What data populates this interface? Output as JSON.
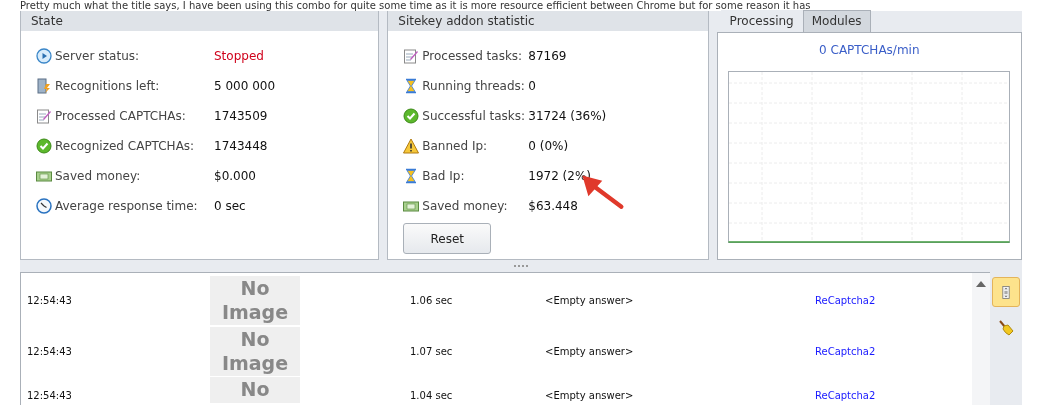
{
  "intro_text": "Pretty much what the title says, I have been using this combo for quite some time as it is more resource efficient between Chrome but for some reason it has",
  "state_panel": {
    "title": "State",
    "rows": [
      {
        "label": "Server status:",
        "value": "Stopped",
        "alert": true
      },
      {
        "label": "Recognitions  left:",
        "value": "5 000 000",
        "alert": false
      },
      {
        "label": "Processed CAPTCHAs:",
        "value": "1743509",
        "alert": false
      },
      {
        "label": "Recognized CAPTCHAs:",
        "value": "1743448",
        "alert": false
      },
      {
        "label": "Saved money:",
        "value": "$0.000",
        "alert": false
      },
      {
        "label": "Average response time:",
        "value": "0 sec",
        "alert": false
      }
    ]
  },
  "sitekey_panel": {
    "title": "Sitekey addon statistic",
    "rows": [
      {
        "label": "Processed tasks:",
        "value": "87169",
        "alert": false
      },
      {
        "label": "Running threads:",
        "value": "0",
        "alert": false
      },
      {
        "label": "Successful tasks:",
        "value": "31724 (36%)",
        "alert": false
      },
      {
        "label": "Banned Ip:",
        "value": "0 (0%)",
        "alert": false
      },
      {
        "label": "Bad Ip:",
        "value": "1972 (2%)",
        "alert": false
      },
      {
        "label": "Saved money:",
        "value": "$63.448",
        "alert": false
      }
    ],
    "reset_button": "Reset"
  },
  "processing_panel": {
    "tabs": [
      {
        "label": "Processing",
        "selected": true
      },
      {
        "label": "Modules",
        "selected": false
      }
    ],
    "rate": "0 CAPTCHAs/min"
  },
  "log": {
    "rows": [
      {
        "time": "12:54:43",
        "image_text": "No Image",
        "duration": "1.06 sec",
        "answer": "<Empty answer>",
        "type": "ReCaptcha2"
      },
      {
        "time": "12:54:43",
        "image_text": "No Image",
        "duration": "1.07 sec",
        "answer": "<Empty answer>",
        "type": "ReCaptcha2"
      },
      {
        "time": "12:54:43",
        "image_text": "No",
        "duration": "1.04 sec",
        "answer": "<Empty answer>",
        "type": "ReCaptcha2"
      }
    ]
  },
  "side_tools": [
    {
      "kind": "scroll",
      "selected": true
    },
    {
      "kind": "broom",
      "selected": false
    }
  ]
}
